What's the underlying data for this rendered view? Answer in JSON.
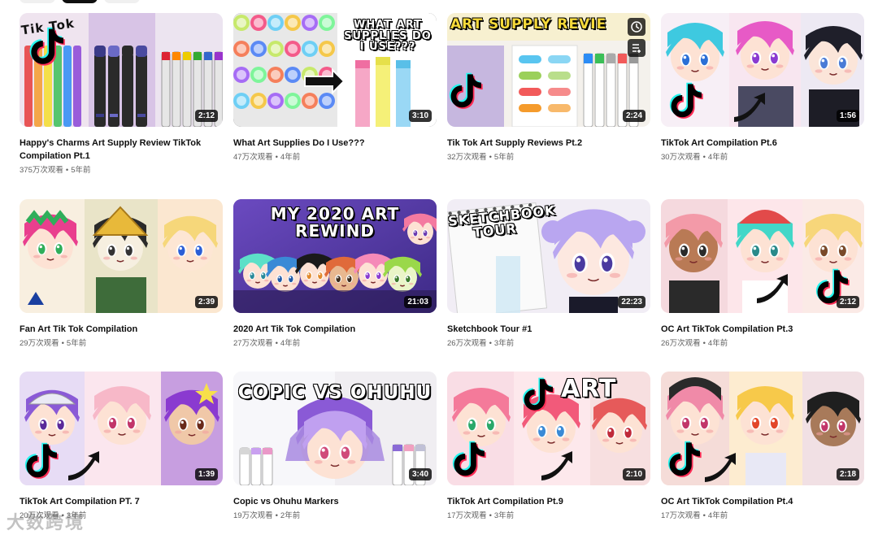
{
  "videos": [
    {
      "title": "Happy's Charms Art Supply Review TikTok Compilation Pt.1",
      "views": "375万次观看",
      "age": "5年前",
      "duration": "2:12",
      "overlay": "Tik Tok",
      "theme": "markers"
    },
    {
      "title": "What Art Supplies Do I Use???",
      "views": "47万次观看",
      "age": "4年前",
      "duration": "3:10",
      "overlay": "WHAT ART SUPPLIES DO I USE???",
      "theme": "supplies"
    },
    {
      "title": "Tik Tok Art Supply Reviews Pt.2",
      "views": "32万次观看",
      "age": "5年前",
      "duration": "2:24",
      "overlay": "ART SUPPLY REVIE",
      "theme": "review"
    },
    {
      "title": "TikTok Art Compilation Pt.6",
      "views": "30万次观看",
      "age": "4年前",
      "duration": "1:56",
      "overlay": "",
      "theme": "oc-blue"
    },
    {
      "title": "Fan Art Tik Tok Compilation",
      "views": "29万次观看",
      "age": "5年前",
      "duration": "2:39",
      "overlay": "",
      "theme": "fanart"
    },
    {
      "title": "2020 Art Tik Tok Compilation",
      "views": "27万次观看",
      "age": "4年前",
      "duration": "21:03",
      "overlay": "MY 2020 ART REWIND",
      "theme": "rewind"
    },
    {
      "title": "Sketchbook Tour #1",
      "views": "26万次观看",
      "age": "3年前",
      "duration": "22:23",
      "overlay": "SKETCHBOOK TOUR",
      "theme": "sketchbook"
    },
    {
      "title": "OC Art TikTok Compilation Pt.3",
      "views": "26万次观看",
      "age": "4年前",
      "duration": "2:12",
      "overlay": "",
      "theme": "oc-pink"
    },
    {
      "title": "TikTok Art Compilation PT. 7",
      "views": "20万次观看",
      "age": "3年前",
      "duration": "1:39",
      "overlay": "",
      "theme": "pt7"
    },
    {
      "title": "Copic vs Ohuhu Markers",
      "views": "19万次观看",
      "age": "2年前",
      "duration": "3:40",
      "overlay": "COPIC VS OHUHU",
      "theme": "copic"
    },
    {
      "title": "TikTok Art Compilation Pt.9",
      "views": "17万次观看",
      "age": "3年前",
      "duration": "2:10",
      "overlay": "ART",
      "theme": "pt9"
    },
    {
      "title": "OC Art TikTok Compilation Pt.4",
      "views": "17万次观看",
      "age": "4年前",
      "duration": "2:18",
      "overlay": "",
      "theme": "oc4"
    }
  ],
  "watermark": "大数跨境",
  "icons": {
    "watch_later": "clock-icon",
    "add_to_queue": "queue-icon",
    "tiktok": "tiktok-logo-icon"
  }
}
